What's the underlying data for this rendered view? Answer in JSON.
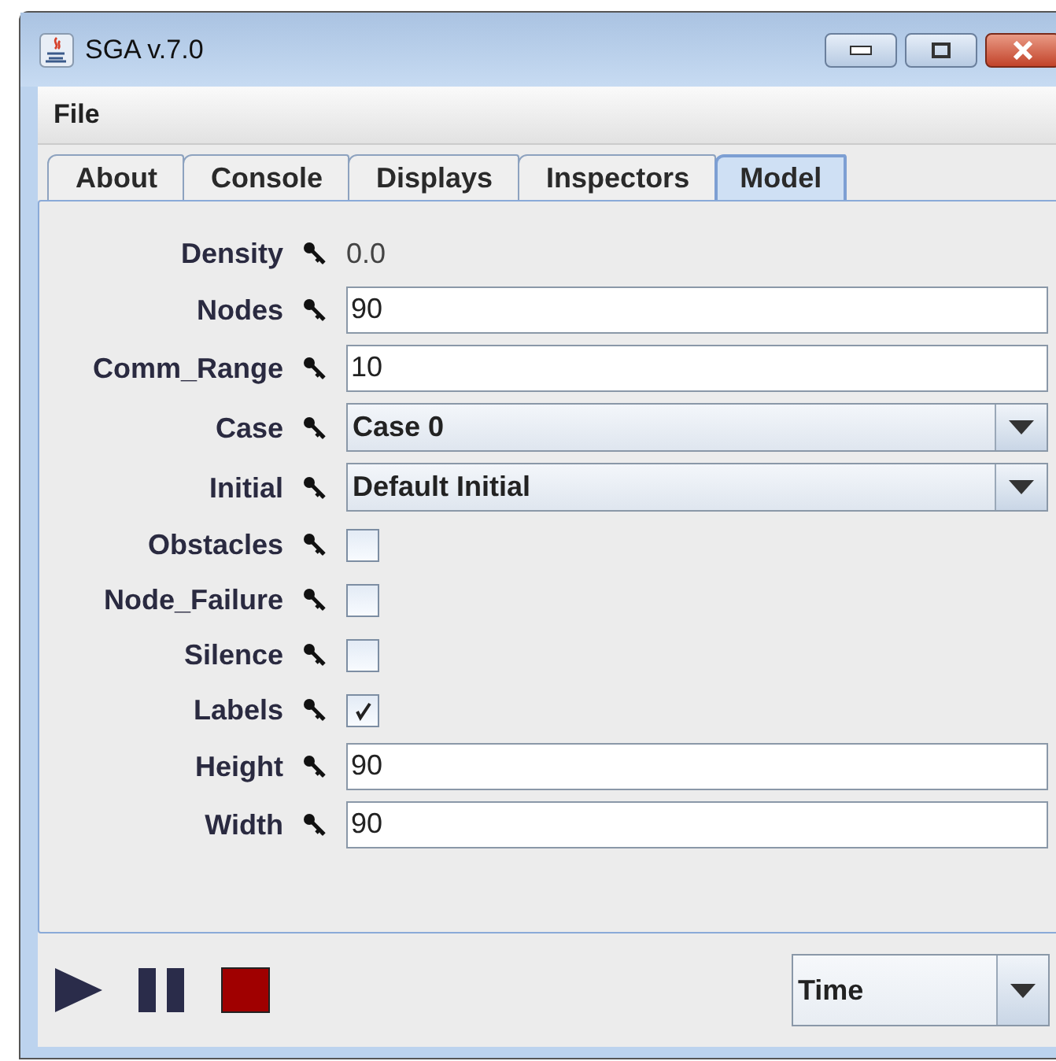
{
  "window": {
    "title": "SGA v.7.0"
  },
  "menu": [
    "File"
  ],
  "tabs": [
    {
      "label": "About",
      "selected": false
    },
    {
      "label": "Console",
      "selected": false
    },
    {
      "label": "Displays",
      "selected": false
    },
    {
      "label": "Inspectors",
      "selected": false
    },
    {
      "label": "Model",
      "selected": true
    }
  ],
  "properties": [
    {
      "label": "Density",
      "kind": "readonly",
      "value": "0.0"
    },
    {
      "label": "Nodes",
      "kind": "text",
      "value": "90"
    },
    {
      "label": "Comm_Range",
      "kind": "text",
      "value": "10"
    },
    {
      "label": "Case",
      "kind": "select",
      "value": "Case 0"
    },
    {
      "label": "Initial",
      "kind": "select",
      "value": "Default Initial"
    },
    {
      "label": "Obstacles",
      "kind": "checkbox",
      "checked": false
    },
    {
      "label": "Node_Failure",
      "kind": "checkbox",
      "checked": false
    },
    {
      "label": "Silence",
      "kind": "checkbox",
      "checked": false
    },
    {
      "label": "Labels",
      "kind": "checkbox",
      "checked": true
    },
    {
      "label": "Height",
      "kind": "text",
      "value": "90"
    },
    {
      "label": "Width",
      "kind": "text",
      "value": "90"
    }
  ],
  "time_selector": {
    "value": "Time"
  }
}
